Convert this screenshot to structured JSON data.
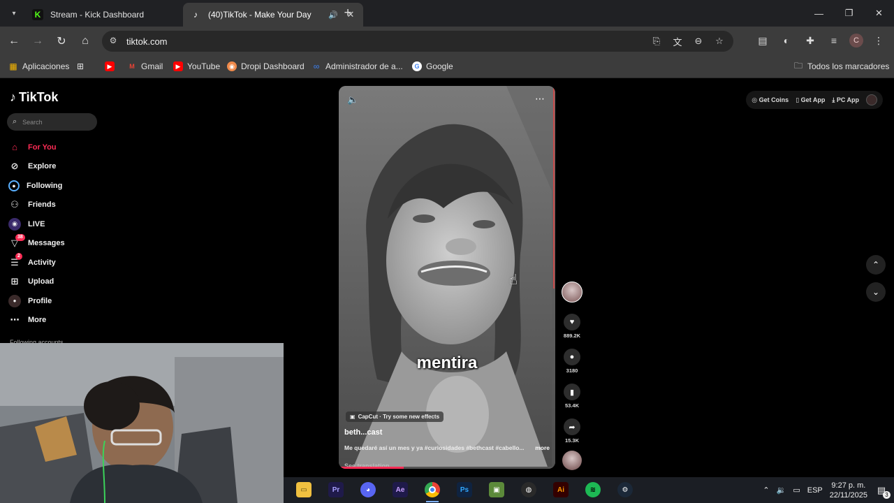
{
  "browser": {
    "tabs": [
      {
        "title": "Stream - Kick Dashboard",
        "favicon": "kick-icon",
        "favicon_color": "#53fc18",
        "active": false
      },
      {
        "title": "(40)TikTok - Make Your Day",
        "favicon": "tiktok-icon",
        "active": true,
        "audio": true
      }
    ],
    "url": "tiktok.com",
    "bookmarks": {
      "apps": "Aplicaciones",
      "gmail": "Gmail",
      "youtube": "YouTube",
      "dropi": "Dropi Dashboard",
      "admin": "Administrador de a...",
      "google": "Google",
      "all": "Todos los marcadores"
    },
    "profile_initial": "C"
  },
  "tiktok": {
    "logo": "TikTok",
    "search_placeholder": "Search",
    "nav": [
      {
        "label": "For You",
        "icon": "home-icon",
        "active": true
      },
      {
        "label": "Explore",
        "icon": "compass-icon"
      },
      {
        "label": "Following",
        "icon": "following-icon"
      },
      {
        "label": "Friends",
        "icon": "friends-icon"
      },
      {
        "label": "LIVE",
        "icon": "live-icon"
      },
      {
        "label": "Messages",
        "icon": "messages-icon",
        "badge": "38"
      },
      {
        "label": "Activity",
        "icon": "activity-icon",
        "badge": "2"
      },
      {
        "label": "Upload",
        "icon": "upload-icon"
      },
      {
        "label": "Profile",
        "icon": "profile-icon"
      },
      {
        "label": "More",
        "icon": "more-icon"
      }
    ],
    "following_accounts_heading": "Following accounts",
    "top_actions": {
      "coins": "Get Coins",
      "app": "Get App",
      "pc": "PC App"
    },
    "video": {
      "overlay_caption": "mentira",
      "effect_label": "CapCut · Try some new effects",
      "author": "beth...cast",
      "description": "Me quedaré así un mes y ya #curiosidades #bethcast #cabello...",
      "more_label": "more",
      "translation_label": "See translation",
      "progress": 0.3
    },
    "actions": {
      "likes": "889.2K",
      "comments": "3180",
      "saves": "53.4K",
      "shares": "15.3K"
    }
  },
  "taskbar": {
    "language": "ESP",
    "time": "9:27 p. m.",
    "date": "22/11/2025",
    "notifications": "3",
    "apps": [
      "file-explorer",
      "premiere",
      "discord",
      "after-effects",
      "chrome",
      "photoshop",
      "minecraft",
      "obs",
      "illustrator",
      "spotify",
      "steam"
    ]
  },
  "colors": {
    "accent": "#fe2c55",
    "chrome_dark": "#202124",
    "chrome_toolbar": "#3c3c3c"
  }
}
